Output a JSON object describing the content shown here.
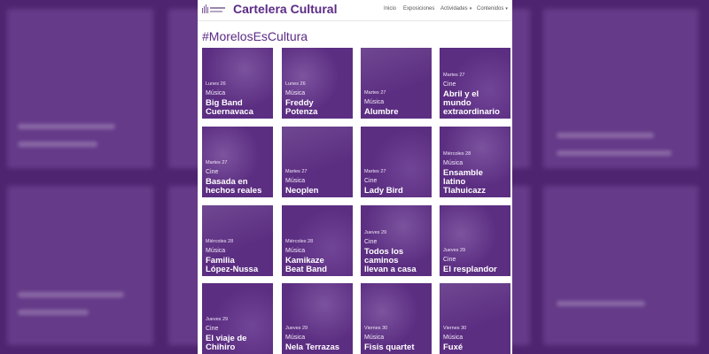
{
  "header": {
    "brand": "Cartelera Cultural",
    "nav": [
      {
        "label": "Inicio",
        "dropdown": false
      },
      {
        "label": "Exposiciones",
        "dropdown": false
      },
      {
        "label": "Actividades",
        "dropdown": true
      },
      {
        "label": "Contenidos",
        "dropdown": true
      }
    ],
    "caret_glyph": "▾"
  },
  "hashtag": "#MorelosEsCultura",
  "colors": {
    "brand": "#5b2a86",
    "card": "#5c2e82",
    "page_bg": "#ffffff",
    "backdrop": "#4e2470"
  },
  "events": [
    {
      "date": "Lunes 26",
      "category": "Música",
      "title": [
        "Big Band",
        "Cuernavaca"
      ]
    },
    {
      "date": "Lunes 26",
      "category": "Música",
      "title": [
        "Freddy",
        "Potenza"
      ]
    },
    {
      "date": "Martes 27",
      "category": "Música",
      "title": [
        "Alumbre"
      ]
    },
    {
      "date": "Martes 27",
      "category": "Cine",
      "title": [
        "Abril y el",
        "mundo",
        "extraordinario"
      ]
    },
    {
      "date": "Martes 27",
      "category": "Cine",
      "title": [
        "Basada en",
        "hechos reales"
      ]
    },
    {
      "date": "Martes 27",
      "category": "Música",
      "title": [
        "Neoplen"
      ]
    },
    {
      "date": "Martes 27",
      "category": "Cine",
      "title": [
        "Lady Bird"
      ]
    },
    {
      "date": "Miércoles 28",
      "category": "Música",
      "title": [
        "Ensamble",
        "latino",
        "Tlahuicazz"
      ]
    },
    {
      "date": "Miércoles 28",
      "category": "Música",
      "title": [
        "Familia",
        "López-Nussa"
      ]
    },
    {
      "date": "Miércoles 28",
      "category": "Música",
      "title": [
        "Kamikaze",
        "Beat Band"
      ]
    },
    {
      "date": "Jueves 29",
      "category": "Cine",
      "title": [
        "Todos los",
        "caminos",
        "llevan a casa"
      ]
    },
    {
      "date": "Jueves 29",
      "category": "Cine",
      "title": [
        "El resplandor"
      ]
    },
    {
      "date": "Jueves 29",
      "category": "Cine",
      "title": [
        "El viaje de",
        "Chihiro"
      ]
    },
    {
      "date": "Jueves 29",
      "category": "Música",
      "title": [
        "Nela Terrazas"
      ]
    },
    {
      "date": "Viernes 30",
      "category": "Música",
      "title": [
        "Fisis quartet"
      ]
    },
    {
      "date": "Viernes 30",
      "category": "Música",
      "title": [
        "Fuxé"
      ]
    }
  ]
}
